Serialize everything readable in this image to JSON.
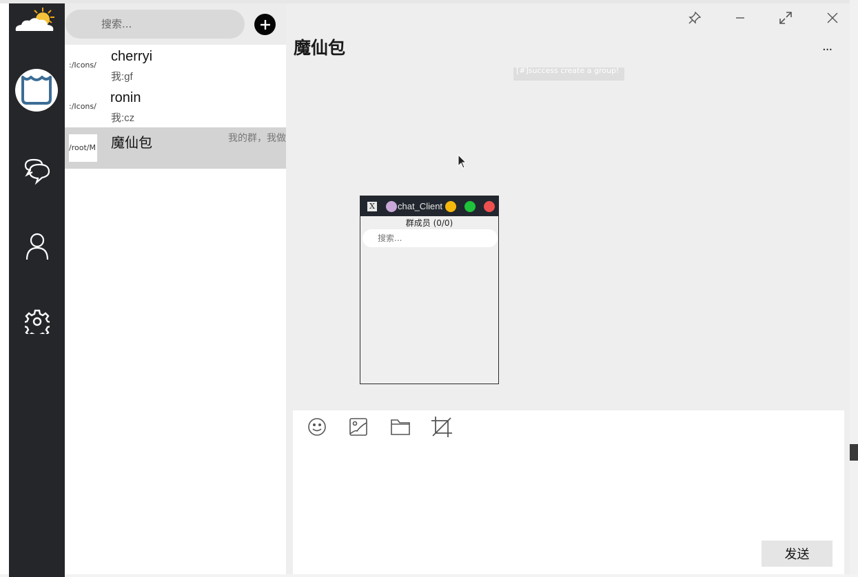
{
  "sidebar": {
    "logo_icon": "weather-sun-cloud-icon",
    "avatar_icon": "bag-avatar-icon",
    "nav": [
      {
        "name": "chat",
        "icon": "chat-bubbles-icon"
      },
      {
        "name": "contacts",
        "icon": "person-icon"
      },
      {
        "name": "settings",
        "icon": "gear-icon"
      }
    ]
  },
  "chat_list": {
    "search_placeholder": "搜索...",
    "add_icon": "plus-icon",
    "items": [
      {
        "thumb_text": ":/Icons/",
        "name": "cherryi",
        "preview": "我:gf",
        "snippet": ""
      },
      {
        "thumb_text": ":/Icons/",
        "name": "ronin",
        "preview": "我:cz",
        "snippet": ""
      },
      {
        "thumb_text": "/root/M",
        "name": "魔仙包",
        "preview": "",
        "snippet": "我的群，我做主"
      }
    ]
  },
  "chat": {
    "title": "魔仙包",
    "more_label": "...",
    "system_message": "[#]success create a group!",
    "window_controls": [
      "pin-icon",
      "minimize-icon",
      "maximize-icon",
      "close-icon"
    ]
  },
  "member_popup": {
    "window_title": "chat_Client",
    "members_label": "群成员 (0/0)",
    "search_placeholder": "搜索...",
    "dot_colors": {
      "purple": "#c9a7d8",
      "yellow": "#f6b70d",
      "green": "#1ec33a",
      "red": "#ee4f4f"
    }
  },
  "input": {
    "tools": [
      "emoji-icon",
      "image-icon",
      "folder-icon",
      "screenshot-crop-icon"
    ],
    "send_label": "发送"
  }
}
